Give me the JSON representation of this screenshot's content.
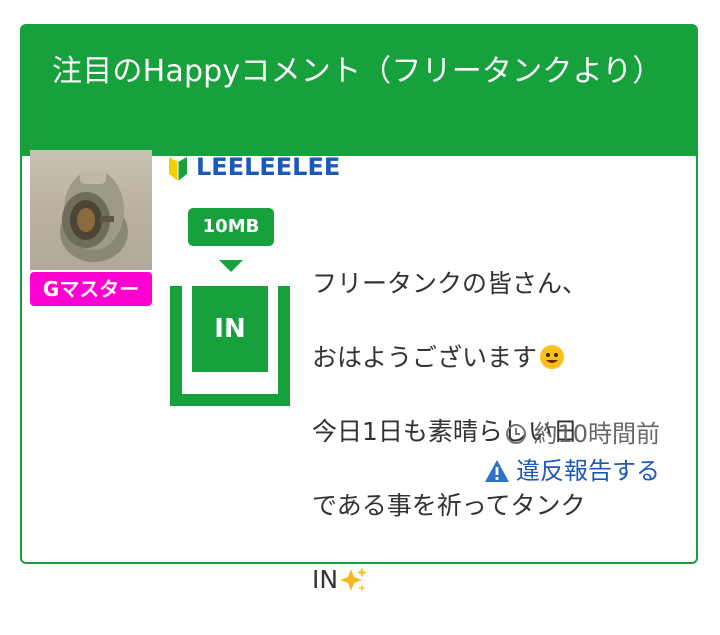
{
  "card": {
    "title": "注目のHappyコメント（フリータンクより）"
  },
  "post": {
    "username": "LEELEELEE",
    "rank_badge": "Gマスター",
    "size_badge": "10MB",
    "tank_label": "IN",
    "comment_lines": [
      "フリータンクの皆さん、",
      "おはようございます",
      "今日1日も素晴らしい日",
      "である事を祈ってタンク",
      "IN"
    ],
    "time_ago": "約10時間前",
    "report_label": "違反報告する",
    "icons": {
      "beginner": "beginner-mark-icon",
      "smile": "smiling-face-emoji",
      "sparkle": "sparkles-emoji",
      "clock": "clock-icon",
      "warning": "warning-icon"
    }
  },
  "colors": {
    "brand_green": "#16a13c",
    "link_blue": "#1c58b8",
    "badge_magenta": "#ff00d0"
  }
}
